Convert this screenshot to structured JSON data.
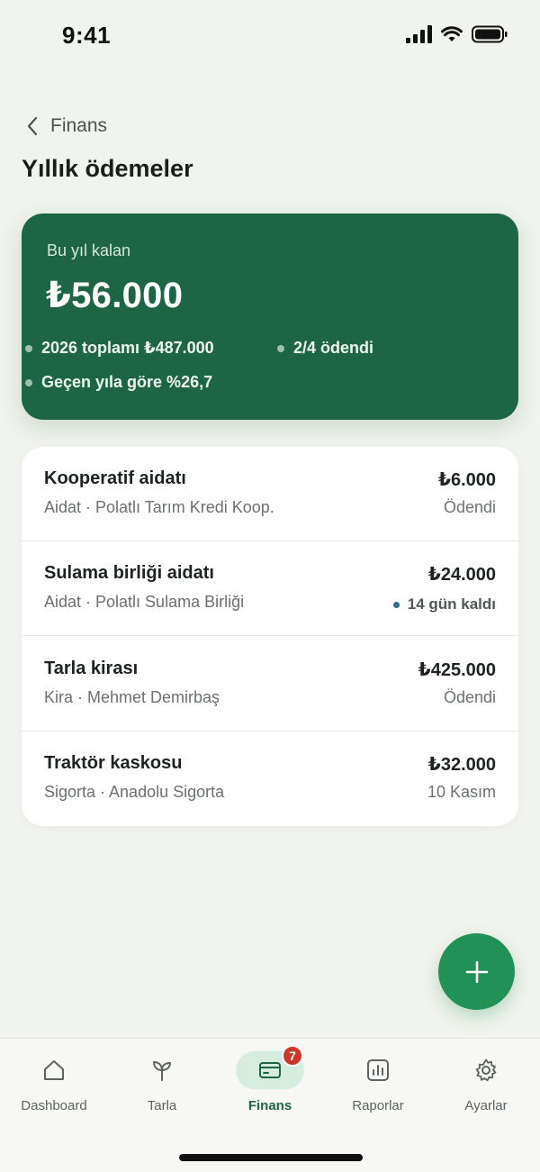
{
  "status_bar": {
    "time": "9:41"
  },
  "header": {
    "back_label": "Finans",
    "title": "Yıllık ödemeler"
  },
  "summary": {
    "label": "Bu yıl kalan",
    "amount": "₺56.000",
    "total": "2026 toplamı ₺487.000",
    "paid": "2/4 ödendi",
    "change": "Geçen yıla göre %26,7"
  },
  "payments": [
    {
      "title": "Kooperatif aidatı",
      "subtitle": "Aidat · Polatlı Tarım Kredi Koop.",
      "amount": "₺6.000",
      "status": "Ödendi",
      "due": false
    },
    {
      "title": "Sulama birliği aidatı",
      "subtitle": "Aidat · Polatlı Sulama Birliği",
      "amount": "₺24.000",
      "status": "14 gün kaldı",
      "due": true
    },
    {
      "title": "Tarla kirası",
      "subtitle": "Kira · Mehmet Demirbaş",
      "amount": "₺425.000",
      "status": "Ödendi",
      "due": false
    },
    {
      "title": "Traktör kaskosu",
      "subtitle": "Sigorta · Anadolu Sigorta",
      "amount": "₺32.000",
      "status": "10 Kasım",
      "due": false
    }
  ],
  "fab": {
    "icon": "plus-icon"
  },
  "tabs": [
    {
      "label": "Dashboard",
      "icon": "home-icon"
    },
    {
      "label": "Tarla",
      "icon": "sprout-icon"
    },
    {
      "label": "Finans",
      "icon": "card-icon",
      "badge": "7",
      "active": true
    },
    {
      "label": "Raporlar",
      "icon": "chart-icon"
    },
    {
      "label": "Ayarlar",
      "icon": "gear-icon"
    }
  ],
  "colors": {
    "background": "#f1f3ee",
    "summary_card": "#1d6544",
    "fab": "#229156",
    "badge": "#c8392c",
    "active_tab": "#1d6544",
    "due_dot": "#2f6f95"
  }
}
